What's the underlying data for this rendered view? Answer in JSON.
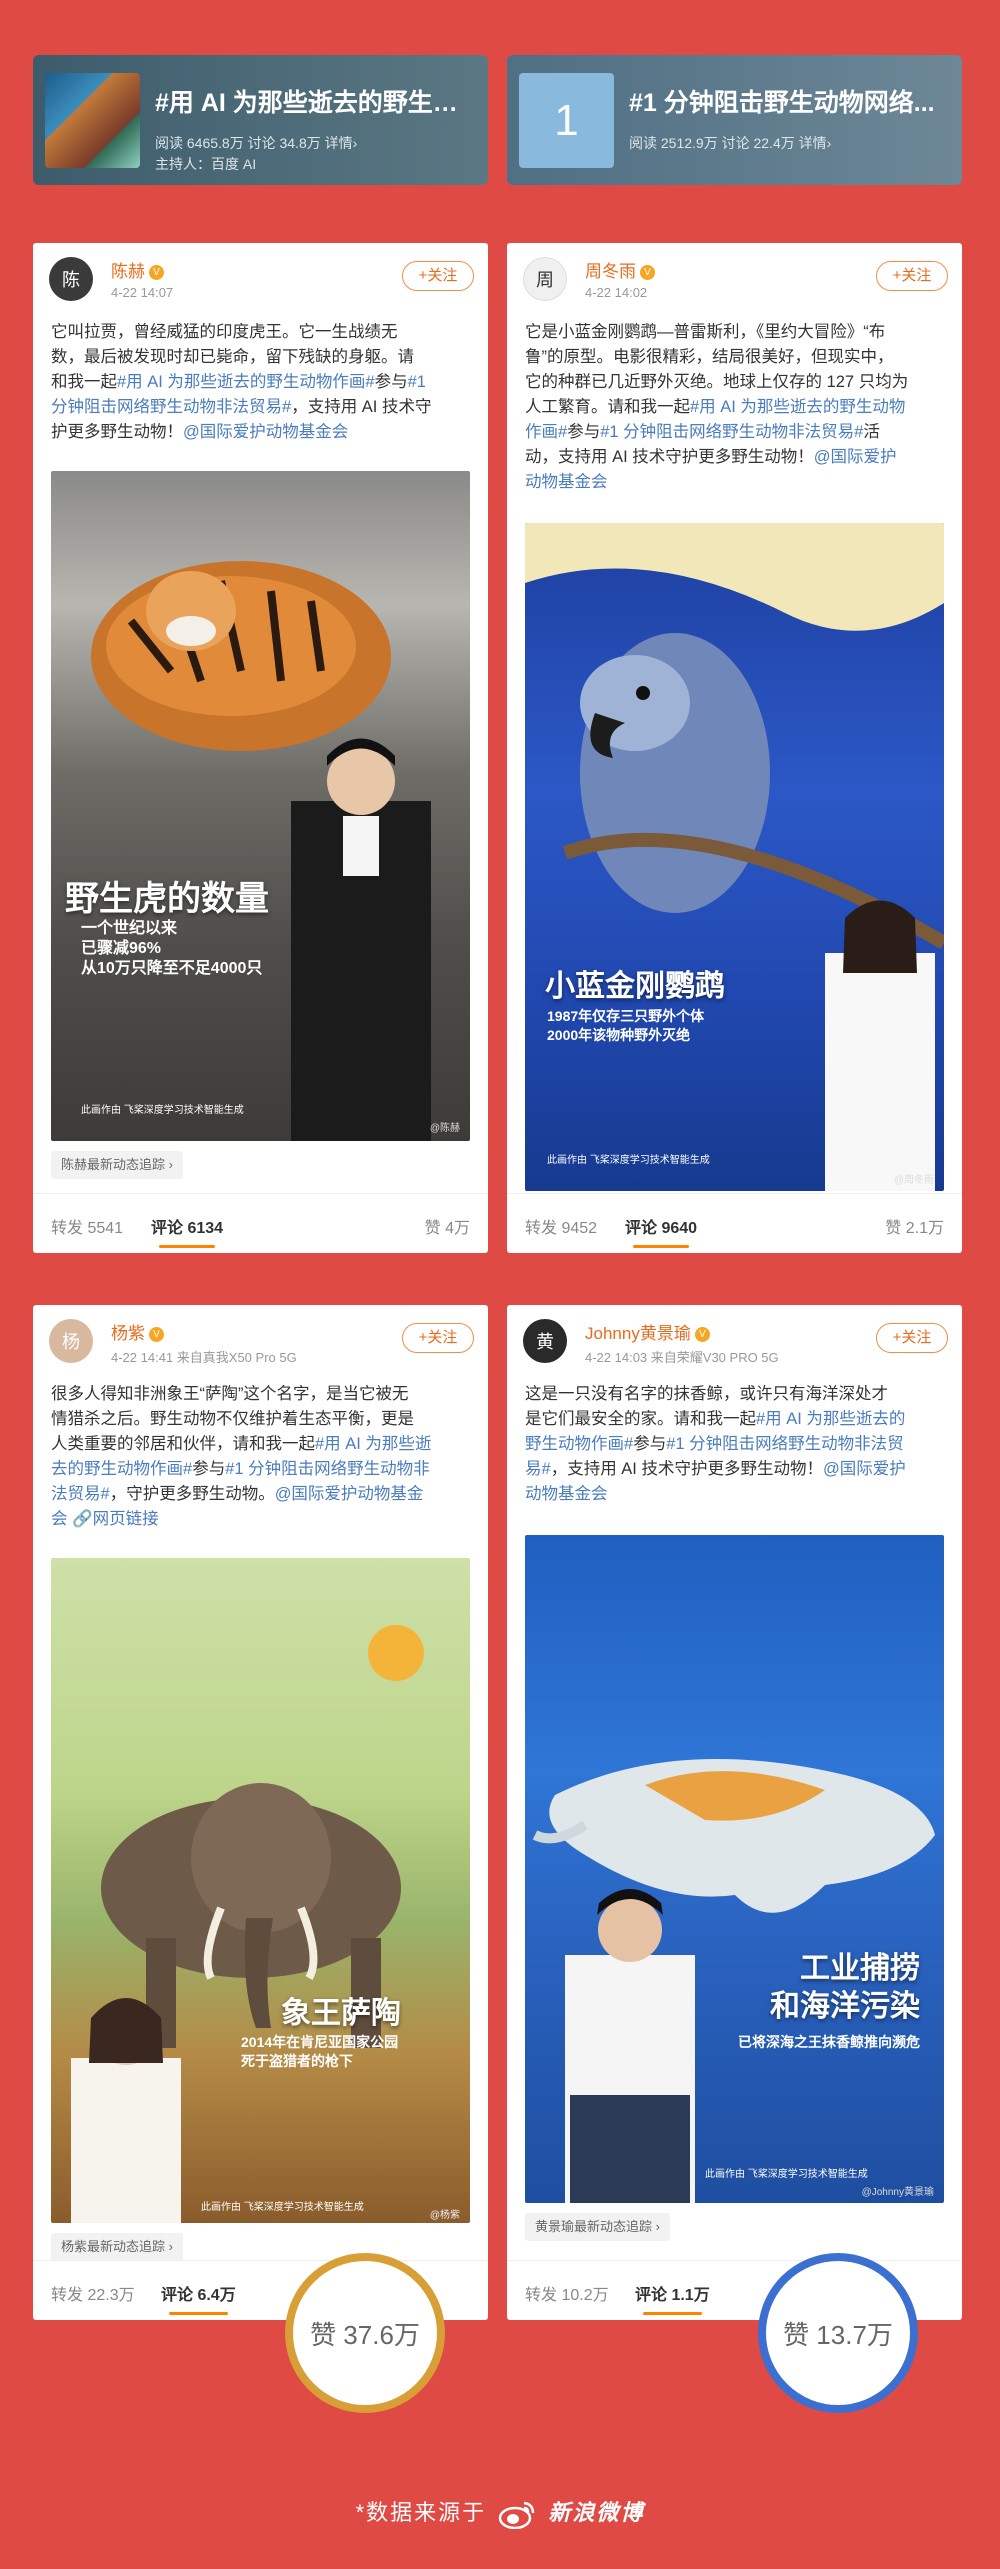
{
  "topics": [
    {
      "title": "#用 AI 为那些逝去的野生动...",
      "meta": "阅读 6465.8万  讨论 34.8万  详情›",
      "host": "主持人：百度 AI"
    },
    {
      "title": "#1 分钟阻击野生动物网络...",
      "badge": "1",
      "meta": "阅读 2512.9万  讨论 22.4万  详情›"
    }
  ],
  "posts": [
    {
      "user": "陈赫",
      "time": "4-22 14:07",
      "follow": "+关注",
      "text": [
        "它叫拉贾，曾经威猛的印度虎王。它一生战绩无",
        "数，最后被发现时却已毙命，留下残缺的身躯。请",
        "和我一起",
        "#用 AI 为那些逝去的野生动物作画#",
        "参与",
        "#1",
        "分钟阻击网络野生动物非法贸易#",
        "，支持用 AI 技术守",
        "护更多野生动物！",
        "@国际爱护动物基金会"
      ],
      "poster_title": "野生虎的数量",
      "poster_sub": "一个世纪以来\n已骤减96%\n从10万只降至不足4000只",
      "poster_credit": "此画作由 飞桨深度学习技术智能生成",
      "watermark": "@陈赫",
      "track": "陈赫最新动态追踪 ›",
      "repost": "转发 5541",
      "comment": "评论 6134",
      "like": "赞 4万"
    },
    {
      "user": "周冬雨",
      "time": "4-22 14:02",
      "follow": "+关注",
      "text": [
        "它是小蓝金刚鹦鹉—普雷斯利，《里约大冒险》“布",
        "鲁”的原型。电影很精彩，结局很美好，但现实中，",
        "它的种群已几近野外灭绝。地球上仅存的 127 只均为",
        "人工繁育。请和我一起",
        "#用 AI 为那些逝去的野生动物",
        "作画#",
        "参与",
        "#1 分钟阻击网络野生动物非法贸易#",
        "活",
        "动，支持用 AI 技术守护更多野生动物！",
        "@国际爱护",
        "动物基金会"
      ],
      "poster_title": "小蓝金刚鹦鹉",
      "poster_sub": "1987年仅存三只野外个体\n2000年该物种野外灭绝",
      "poster_credit": "此画作由 飞桨深度学习技术智能生成",
      "watermark": "@周冬雨",
      "repost": "转发 9452",
      "comment": "评论 9640",
      "like": "赞 2.1万"
    },
    {
      "user": "杨紫",
      "time": "4-22 14:41  来自真我X50 Pro 5G",
      "follow": "+关注",
      "text": [
        "很多人得知非洲象王“萨陶”这个名字，是当它被无",
        "情猎杀之后。野生动物不仅维护着生态平衡，更是",
        "人类重要的邻居和伙伴，请和我一起",
        "#用 AI 为那些逝",
        "去的野生动物作画#",
        "参与",
        "#1 分钟阻击网络野生动物非",
        "法贸易#",
        "，守护更多野生动物。",
        "@国际爱护动物基金",
        "会 ",
        "🔗网页链接"
      ],
      "poster_title": "象王萨陶",
      "poster_sub": "2014年在肯尼亚国家公园\n死于盗猎者的枪下",
      "poster_credit": "此画作由 飞桨深度学习技术智能生成",
      "watermark": "@杨紫",
      "track": "杨紫最新动态追踪 ›",
      "repost": "转发 22.3万",
      "comment": "评论 6.4万",
      "like": "赞 37.6万"
    },
    {
      "user": "Johnny黄景瑜",
      "time": "4-22 14:03  来自荣耀V30 PRO 5G",
      "follow": "+关注",
      "text": [
        "这是一只没有名字的抹香鲸，或许只有海洋深处才",
        "是它们最安全的家。请和我一起",
        "#用 AI 为那些逝去的",
        "野生动物作画#",
        "参与",
        "#1 分钟阻击网络野生动物非法贸",
        "易#",
        "，支持用 AI 技术守护更多野生动物！",
        "@国际爱护",
        "动物基金会"
      ],
      "poster_title": "工业捕捞\n和海洋污染",
      "poster_sub": "已将深海之王抹香鲸推向濒危",
      "poster_credit": "此画作由 飞桨深度学习技术智能生成",
      "watermark": "@Johnny黄景瑜",
      "track": "黄景瑜最新动态追踪 ›",
      "repost": "转发 10.2万",
      "comment": "评论 1.1万",
      "like": "赞 13.7万"
    }
  ],
  "source": "*数据来源于",
  "source_brand": "新浪微博",
  "colors": {
    "background": "#e04a44",
    "accent": "#e86b1d",
    "link": "#4a7cbe",
    "ring1": "#d79f35",
    "ring2": "#3b6fd0"
  }
}
